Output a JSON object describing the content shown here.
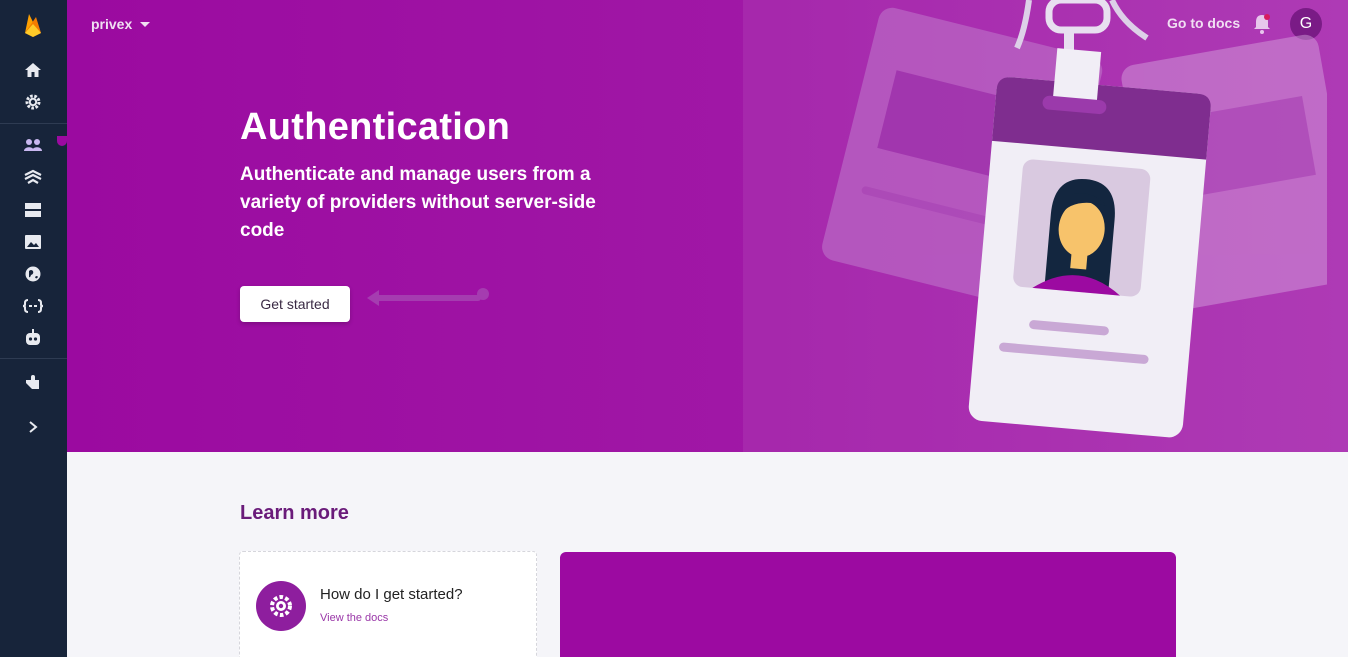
{
  "app": {
    "project_name": "privex",
    "brand_color": "#9c0aa1"
  },
  "sidebar": {
    "logo": "firebase-flame-icon",
    "items": [
      {
        "icon": "home-icon"
      },
      {
        "icon": "gear-icon"
      },
      {
        "icon": "people-icon"
      },
      {
        "icon": "firestore-icon"
      },
      {
        "icon": "database-icon"
      },
      {
        "icon": "storage-image-icon"
      },
      {
        "icon": "globe-icon"
      },
      {
        "icon": "functions-icon"
      },
      {
        "icon": "ml-robot-icon"
      },
      {
        "icon": "extensions-icon"
      },
      {
        "icon": "chevron-right-icon"
      }
    ]
  },
  "header": {
    "docs_link": "Go to docs",
    "avatar_letter": "G"
  },
  "hero": {
    "title": "Authentication",
    "subtitle": "Authenticate and manage users from a variety of providers without server-side code",
    "cta_label": "Get started"
  },
  "learn_more": {
    "title": "Learn more",
    "card": {
      "title": "How do I get started?",
      "link": "View the docs",
      "icon": "gear-icon"
    }
  }
}
